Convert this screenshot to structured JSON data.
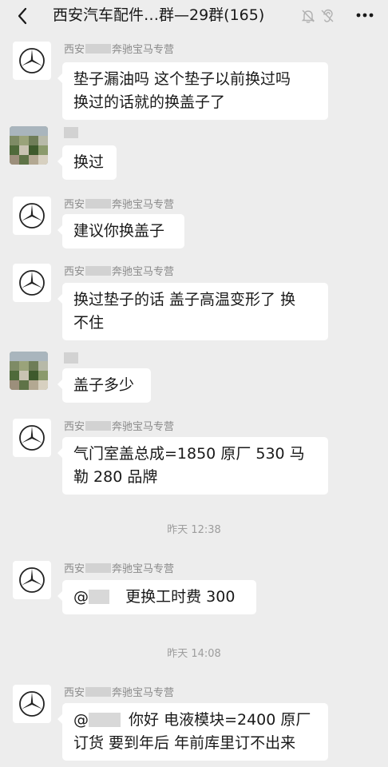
{
  "header": {
    "title": "西安汽车配件…群—29群(165)"
  },
  "messages": [
    {
      "sender": "西安 奔驰宝马专营",
      "text_lines": [
        "垫子漏油吗 这个垫子以前换过吗",
        "换过的话就的换盖子了"
      ]
    },
    {
      "sender": "",
      "text_lines": [
        "换过"
      ]
    },
    {
      "sender": "西安 奔驰宝马专营",
      "text_lines": [
        "建议你换盖子"
      ]
    },
    {
      "sender": "西安 奔驰宝马专营",
      "text_lines": [
        "换过垫子的话 盖子高温变形了  换",
        "不住"
      ]
    },
    {
      "sender": "",
      "text_lines": [
        "盖子多少"
      ]
    },
    {
      "sender": "西安 奔驰宝马专营",
      "text_lines": [
        "气门室盖总成=1850 原厂   530 马",
        "勒   280 品牌"
      ]
    },
    {
      "sender": "西安 奔驰宝马专营",
      "mention": "@",
      "text_lines": [
        "更换工时费 300"
      ]
    },
    {
      "sender": "西安 奔驰宝马专营",
      "mention": "@",
      "text_lines": [
        "你好 电液模块=2400 原厂",
        "订货  要到年后 年前库里订不出来"
      ]
    }
  ],
  "sender_prefix": "西安",
  "sender_suffix": "奔驰宝马专营",
  "timestamps": [
    "昨天 12:38",
    "昨天 14:08"
  ],
  "icons": {
    "back": "chevron-left-icon",
    "mute": "mute-bell-icon",
    "ear": "ear-icon",
    "more": "more-dots-icon",
    "avatar_benz": "mercedes-star-icon"
  },
  "colors": {
    "background": "#ededed",
    "bubble": "#ffffff",
    "text": "#191919",
    "sender": "#8a8a8a"
  }
}
